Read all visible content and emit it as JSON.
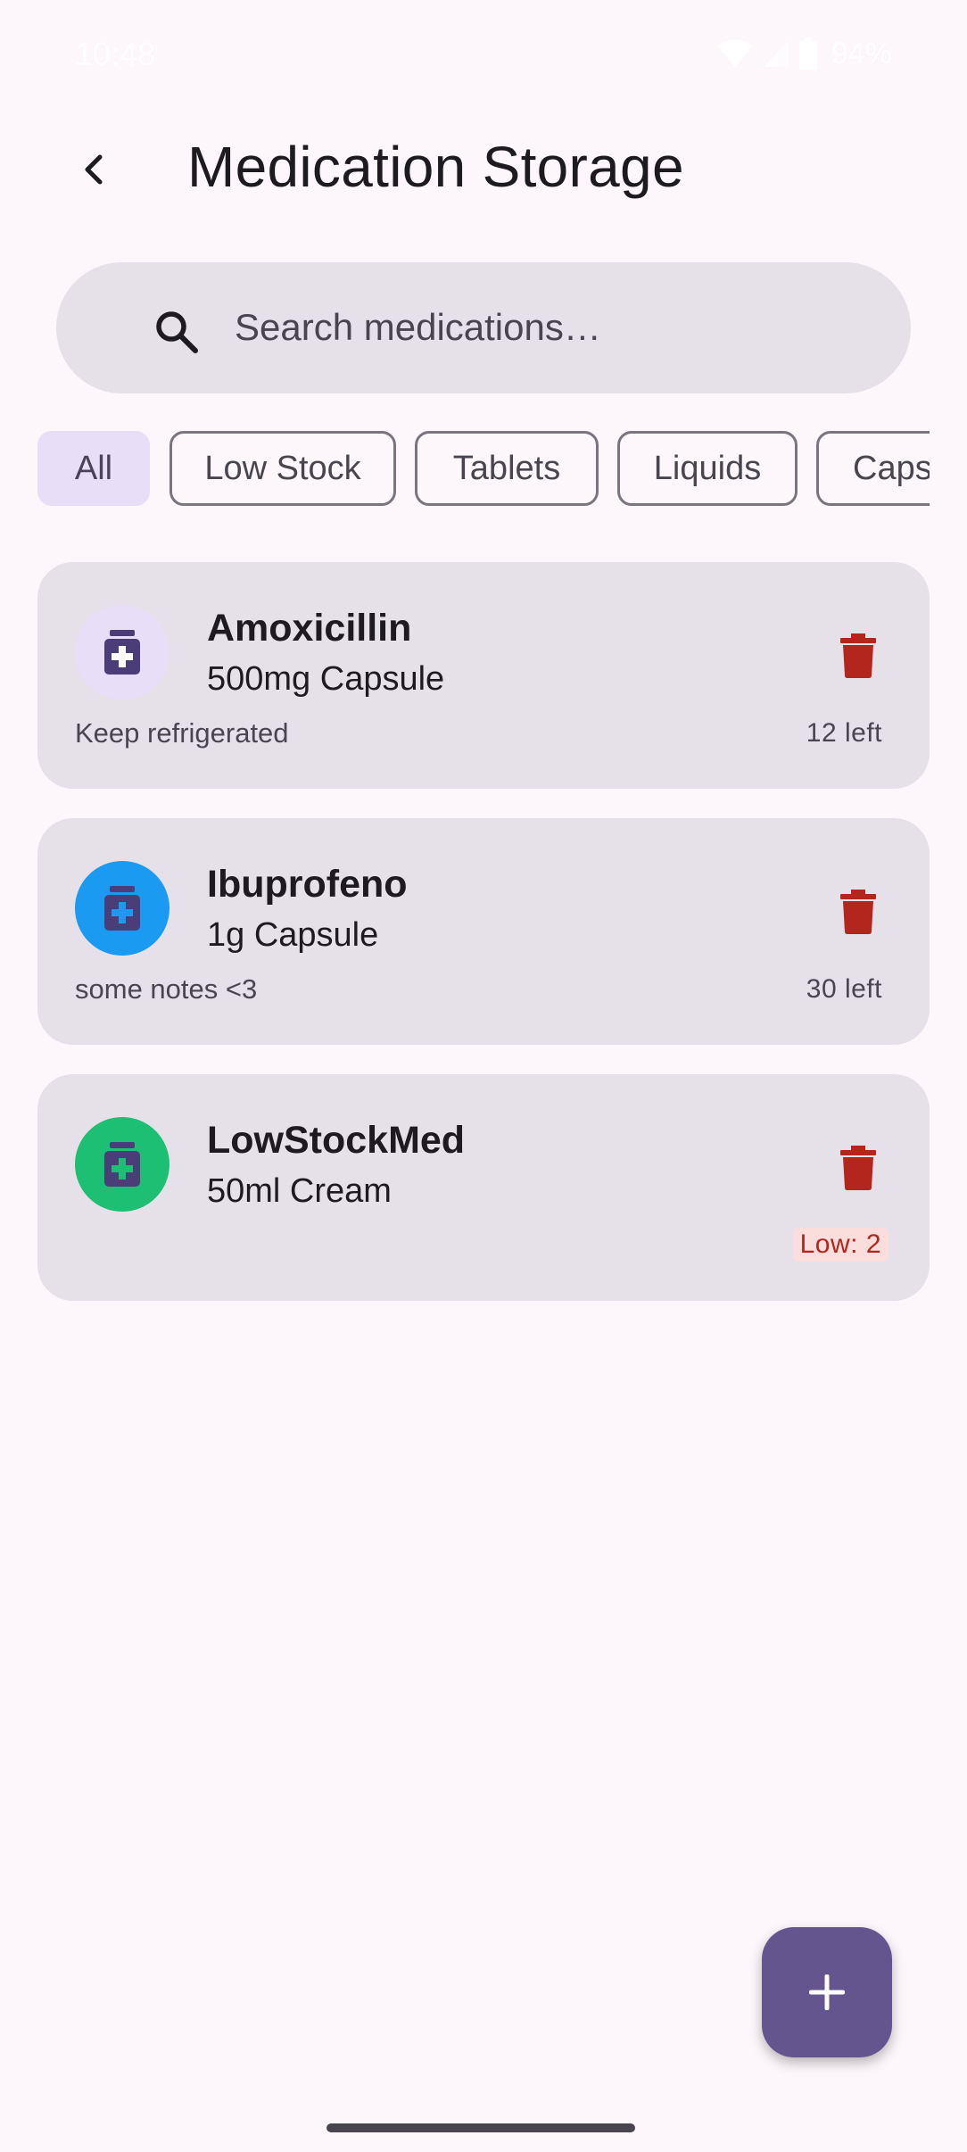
{
  "status_bar": {
    "time": "10:48",
    "battery": "94%",
    "icons": [
      "wifi-icon",
      "signal-icon",
      "battery-icon"
    ]
  },
  "app_bar": {
    "title": "Medication Storage",
    "back_icon": "arrow-back-icon"
  },
  "search": {
    "placeholder": "Search medications…",
    "value": "",
    "icon": "search-icon"
  },
  "filters": {
    "selected": "All",
    "chips": [
      "All",
      "Low Stock",
      "Tablets",
      "Liquids",
      "Caps"
    ]
  },
  "medications": [
    {
      "name": "Amoxicillin",
      "dose": "500mg Capsule",
      "notes": "Keep refrigerated",
      "stock": "12 left",
      "low_stock": false,
      "avatar_bg": "#e8def8",
      "cross_color": "#ffffff"
    },
    {
      "name": "Ibuprofeno",
      "dose": "1g Capsule",
      "notes": "some notes <3",
      "stock": "30 left",
      "low_stock": false,
      "avatar_bg": "#1a9af0",
      "cross_color": "#1a9af0"
    },
    {
      "name": "LowStockMed",
      "dose": "50ml Cream",
      "notes": "",
      "stock": "Low: 2",
      "low_stock": true,
      "avatar_bg": "#1dc073",
      "cross_color": "#1dc073"
    }
  ],
  "fab": {
    "icon": "add-icon"
  },
  "colors": {
    "background": "#fdf7fc",
    "card": "#e6e0e9",
    "primary": "#65558f",
    "delete": "#b3261e",
    "bottle": "#4a3d78",
    "low_badge_bg": "#f9dedc"
  }
}
